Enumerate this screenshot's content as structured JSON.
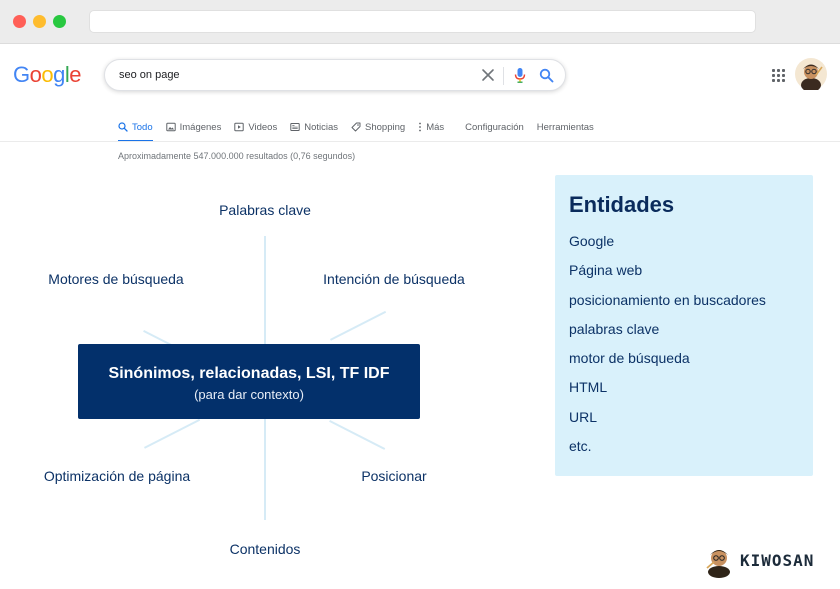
{
  "browser": {
    "url": ""
  },
  "google": {
    "logo_letters": [
      {
        "char": "G",
        "color": "#4285F4"
      },
      {
        "char": "o",
        "color": "#EA4335"
      },
      {
        "char": "o",
        "color": "#FBBC05"
      },
      {
        "char": "g",
        "color": "#4285F4"
      },
      {
        "char": "l",
        "color": "#34A853"
      },
      {
        "char": "e",
        "color": "#EA4335"
      }
    ],
    "search": {
      "value": "seo on page"
    },
    "tabs": [
      {
        "label": "Todo",
        "icon": "search-icon",
        "active": true
      },
      {
        "label": "Imágenes",
        "icon": "image-icon",
        "active": false
      },
      {
        "label": "Videos",
        "icon": "video-icon",
        "active": false
      },
      {
        "label": "Noticias",
        "icon": "news-icon",
        "active": false
      },
      {
        "label": "Shopping",
        "icon": "tag-icon",
        "active": false
      },
      {
        "label": "Más",
        "icon": "more-vert-icon",
        "active": false
      }
    ],
    "settings_label": "Configuración",
    "tools_label": "Herramientas",
    "results_count": "Aproximadamente 547.000.000 resultados (0,76 segundos)"
  },
  "diagram": {
    "top": "Palabras clave",
    "top_left": "Motores de búsqueda",
    "top_right": "Intención de búsqueda",
    "bottom_left": "Optimización de página",
    "bottom_right": "Posicionar",
    "bottom": "Contenidos",
    "center_title": "Sinónimos, relacionadas, LSI, TF IDF",
    "center_subtitle": "(para dar contexto)"
  },
  "entities": {
    "title": "Entidades",
    "items": [
      "Google",
      "Página web",
      "posicionamiento en buscadores",
      "palabras clave",
      "motor de búsqueda",
      "HTML",
      "URL",
      "etc."
    ]
  },
  "brand": {
    "name": "KIWOSAN"
  },
  "colors": {
    "accent_blue": "#1a73e8",
    "diagram_text": "#0c3266",
    "center_box": "#03306b",
    "entities_bg": "#d9f1fb",
    "spoke": "#d6ebf6"
  }
}
